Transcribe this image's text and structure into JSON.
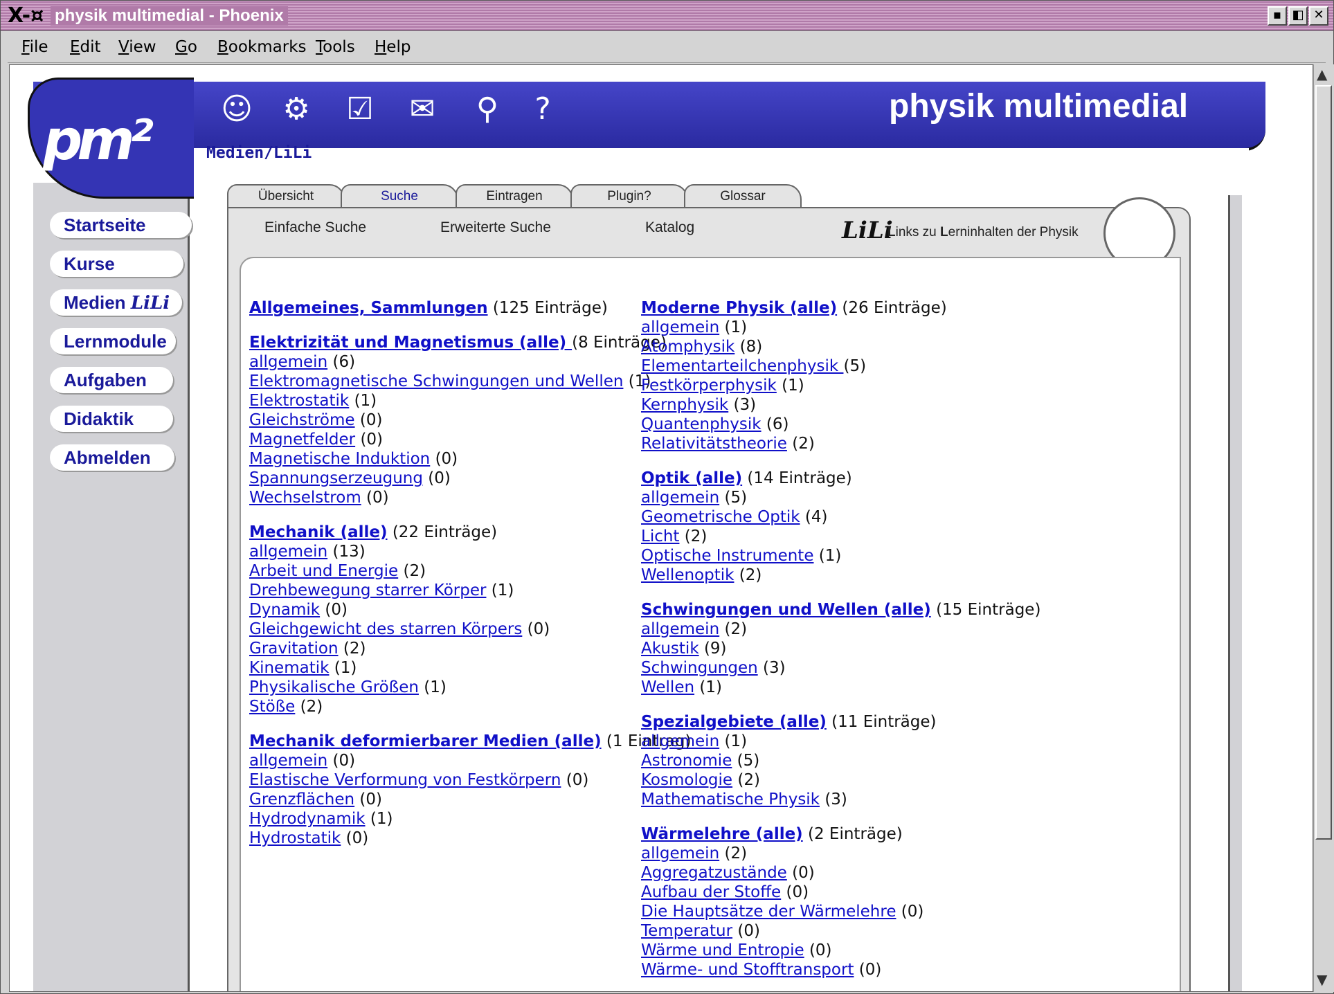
{
  "window": {
    "title": "physik multimedial - Phoenix"
  },
  "menubar": [
    "File",
    "Edit",
    "View",
    "Go",
    "Bookmarks",
    "Tools",
    "Help"
  ],
  "header": {
    "logo": "pm²",
    "site_name": "physik multimedial",
    "breadcrumb": "Medien/LiLi",
    "icons": [
      "face-icon",
      "gears-icon",
      "checklist-icon",
      "mail-icon",
      "binoculars-icon",
      "help-icon"
    ]
  },
  "sidebar": [
    {
      "label": "Startseite"
    },
    {
      "label": "Kurse"
    },
    {
      "label": "Medien",
      "suffix": "LiLi"
    },
    {
      "label": "Lernmodule"
    },
    {
      "label": "Aufgaben"
    },
    {
      "label": "Didaktik"
    },
    {
      "label": "Abmelden"
    }
  ],
  "tabs": [
    {
      "label": "Übersicht"
    },
    {
      "label": "Suche",
      "active": true
    },
    {
      "label": "Eintragen"
    },
    {
      "label": "Plugin?"
    },
    {
      "label": "Glossar"
    }
  ],
  "subnav": [
    "Einfache Suche",
    "Erweiterte Suche",
    "Katalog"
  ],
  "lili": {
    "logo": "LiLi",
    "tagline_parts": [
      "L",
      "inks zu ",
      "L",
      "ern",
      "inhalten der Physik"
    ]
  },
  "left_column": [
    {
      "title": "Allgemeines, Sammlungen",
      "count": "(125 Einträge)",
      "items": []
    },
    {
      "title": "Elektrizität und Magnetismus (alle) ",
      "count": "(8 Einträge)",
      "items": [
        [
          "allgemein",
          "(6)"
        ],
        [
          "Elektromagnetische Schwingungen und Wellen",
          "(1)"
        ],
        [
          "Elektrostatik",
          "(1)"
        ],
        [
          "Gleichströme",
          "(0)"
        ],
        [
          "Magnetfelder",
          "(0)"
        ],
        [
          "Magnetische Induktion",
          "(0)"
        ],
        [
          "Spannungserzeugung",
          "(0)"
        ],
        [
          "Wechselstrom",
          "(0)"
        ]
      ]
    },
    {
      "title": "Mechanik (alle)",
      "count": "(22 Einträge)",
      "items": [
        [
          "allgemein",
          "(13)"
        ],
        [
          "Arbeit und Energie",
          "(2)"
        ],
        [
          "Drehbewegung starrer Körper",
          "(1)"
        ],
        [
          "Dynamik",
          "(0)"
        ],
        [
          "Gleichgewicht des starren Körpers",
          "(0)"
        ],
        [
          "Gravitation",
          "(2)"
        ],
        [
          "Kinematik",
          "(1)"
        ],
        [
          "Physikalische Größen",
          "(1)"
        ],
        [
          "Stöße",
          "(2)"
        ]
      ]
    },
    {
      "title": "Mechanik deformierbarer Medien (alle)",
      "count": "(1 Eintrag)",
      "items": [
        [
          "allgemein",
          "(0)"
        ],
        [
          "Elastische Verformung von Festkörpern",
          "(0)"
        ],
        [
          "Grenzflächen",
          "(0)"
        ],
        [
          "Hydrodynamik",
          "(1)"
        ],
        [
          "Hydrostatik",
          "(0)"
        ]
      ]
    }
  ],
  "right_column": [
    {
      "title": "Moderne Physik (alle)",
      "count": "(26 Einträge)",
      "items": [
        [
          "allgemein",
          "(1)"
        ],
        [
          "Atomphysik",
          "(8)"
        ],
        [
          "Elementarteilchenphysik ",
          "(5)"
        ],
        [
          "Festkörperphysik",
          "(1)"
        ],
        [
          "Kernphysik",
          "(3)"
        ],
        [
          "Quantenphysik",
          "(6)"
        ],
        [
          "Relativitätstheorie",
          "(2)"
        ]
      ]
    },
    {
      "title": "Optik (alle)",
      "count": "(14 Einträge)",
      "items": [
        [
          "allgemein",
          "(5)"
        ],
        [
          "Geometrische Optik",
          "(4)"
        ],
        [
          "Licht",
          "(2)"
        ],
        [
          "Optische Instrumente",
          "(1)"
        ],
        [
          "Wellenoptik",
          "(2)"
        ]
      ]
    },
    {
      "title": "Schwingungen und Wellen (alle)",
      "count": "(15 Einträge)",
      "items": [
        [
          "allgemein",
          "(2)"
        ],
        [
          "Akustik",
          "(9)"
        ],
        [
          "Schwingungen",
          "(3)"
        ],
        [
          "Wellen",
          "(1)"
        ]
      ]
    },
    {
      "title": "Spezialgebiete (alle)",
      "count": "(11 Einträge)",
      "items": [
        [
          "allgemein",
          "(1)"
        ],
        [
          "Astronomie",
          "(5)"
        ],
        [
          "Kosmologie",
          "(2)"
        ],
        [
          "Mathematische Physik",
          "(3)"
        ]
      ]
    },
    {
      "title": "Wärmelehre (alle)",
      "count": "(2 Einträge)",
      "items": [
        [
          "allgemein",
          "(2)"
        ],
        [
          "Aggregatzustände",
          "(0)"
        ],
        [
          "Aufbau der Stoffe",
          "(0)"
        ],
        [
          "Die Hauptsätze der Wärmelehre",
          "(0)"
        ],
        [
          "Temperatur",
          "(0)"
        ],
        [
          "Wärme und Entropie",
          "(0)"
        ],
        [
          "Wärme- und Stofftransport",
          "(0)"
        ]
      ]
    }
  ]
}
